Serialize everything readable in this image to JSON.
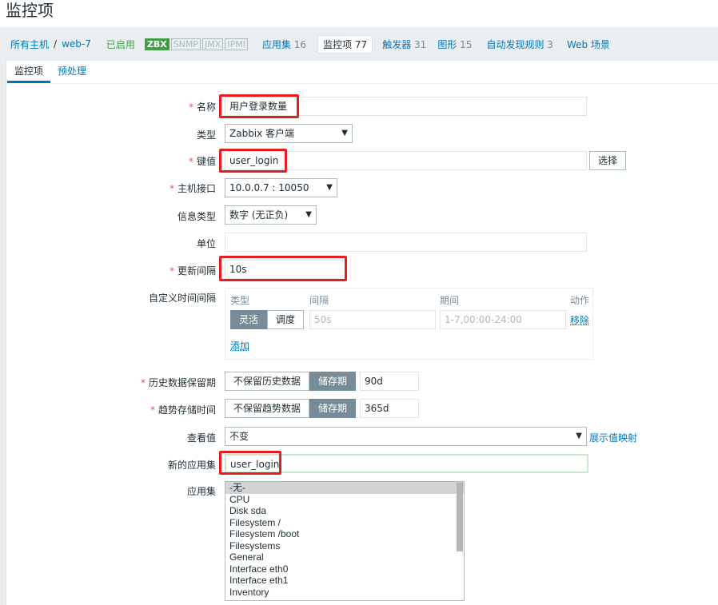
{
  "page": {
    "title": "监控项"
  },
  "nav": {
    "hosts_link": "所有主机",
    "separator": "/",
    "host_name": "web-7",
    "status": "已启用",
    "interfaces": [
      "ZBX",
      "SNMP",
      "JMX",
      "IPMI"
    ],
    "tabs": [
      {
        "label": "应用集",
        "count": "16"
      },
      {
        "label": "监控项",
        "count": "77"
      },
      {
        "label": "触发器",
        "count": "31"
      },
      {
        "label": "图形",
        "count": "15"
      },
      {
        "label": "自动发现规则",
        "count": "3"
      },
      {
        "label": "Web 场景",
        "count": ""
      }
    ]
  },
  "form_tabs": [
    "监控项",
    "预处理"
  ],
  "form": {
    "required_mark": "*",
    "name": {
      "label": "名称",
      "value": "用户登录数量"
    },
    "type": {
      "label": "类型",
      "value": "Zabbix 客户端"
    },
    "key": {
      "label": "键值",
      "value": "user_login",
      "button": "选择"
    },
    "interface": {
      "label": "主机接口",
      "value": "10.0.0.7 : 10050"
    },
    "info_type": {
      "label": "信息类型",
      "value": "数字 (无正负)"
    },
    "units": {
      "label": "单位",
      "value": ""
    },
    "interval": {
      "label": "更新间隔",
      "value": "10s"
    },
    "custom_intervals": {
      "label": "自定义时间间隔",
      "headers": [
        "类型",
        "间隔",
        "期间",
        "动作"
      ],
      "type_options": [
        "灵活",
        "调度"
      ],
      "interval_placeholder": "50s",
      "period_placeholder": "1-7,00:00-24:00",
      "remove": "移除",
      "add": "添加"
    },
    "history": {
      "label": "历史数据保留期",
      "options": [
        "不保留历史数据",
        "储存期"
      ],
      "value": "90d"
    },
    "trends": {
      "label": "趋势存储时间",
      "options": [
        "不保留趋势数据",
        "储存期"
      ],
      "value": "365d"
    },
    "valuemap": {
      "label": "查看值",
      "value": "不变",
      "link": "展示值映射"
    },
    "new_application": {
      "label": "新的应用集",
      "value": "user_login"
    },
    "applications": {
      "label": "应用集",
      "options": [
        "-无-",
        "CPU",
        "Disk sda",
        "Filesystem /",
        "Filesystem /boot",
        "Filesystems",
        "General",
        "Interface eth0",
        "Interface eth1",
        "Inventory"
      ]
    }
  },
  "colors": {
    "link": "#0275b8",
    "highlight": "#e22020",
    "enabled": "#429e47",
    "required": "#e45959"
  }
}
